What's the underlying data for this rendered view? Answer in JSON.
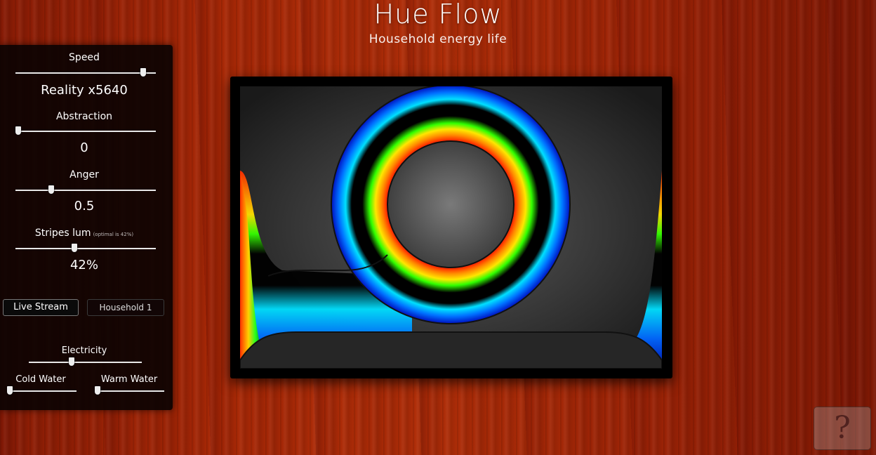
{
  "header": {
    "title": "Hue Flow",
    "subtitle": "Household energy life"
  },
  "controls": {
    "speed": {
      "label": "Speed",
      "value": "Reality x5640",
      "level": 0.9
    },
    "abstraction": {
      "label": "Abstraction",
      "value": "0",
      "level": 0.0
    },
    "anger": {
      "label": "Anger",
      "value": "0.5",
      "level": 0.25
    },
    "stripes": {
      "label": "Stripes lum",
      "note": "(optimal is 42%)",
      "value": "42%",
      "level": 0.42
    }
  },
  "buttons": {
    "live_stream": "Live Stream",
    "household": "Household 1"
  },
  "meters": {
    "electricity": {
      "label": "Electricity",
      "level": 0.38
    },
    "cold_water": {
      "label": "Cold Water",
      "level": 0.0
    },
    "warm_water": {
      "label": "Warm Water",
      "level": 0.0
    }
  },
  "help": {
    "glyph": "?",
    "icon": "help-icon"
  },
  "colors": {
    "accent": "#ffffff",
    "wood": "#a82806",
    "panel": "#0a0202"
  }
}
